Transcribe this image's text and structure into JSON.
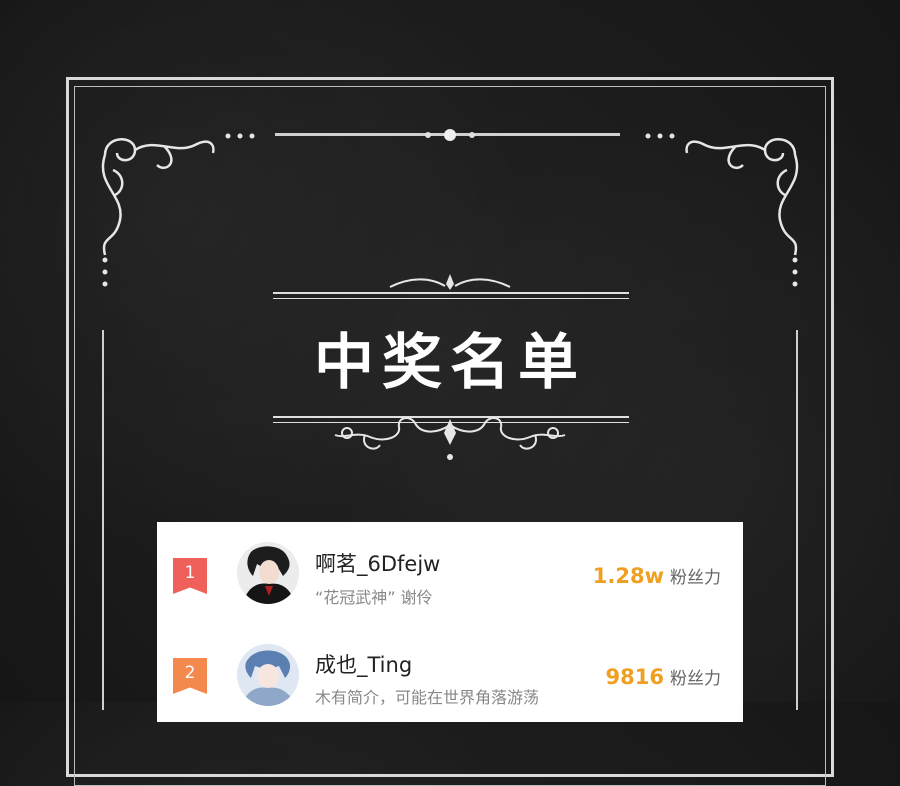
{
  "title": "中奖名单",
  "colors": {
    "badge_first": "#f0605a",
    "badge_second": "#f4894d",
    "fans_accent": "#f0a020"
  },
  "winners": [
    {
      "rank": "1",
      "name": "啊茗_6Dfejw",
      "signature": "“花冠武神” 谢伶",
      "fans_count": "1.28w",
      "fans_label": "粉丝力"
    },
    {
      "rank": "2",
      "name": "成也_Ting",
      "signature": "木有简介，可能在世界角落游荡",
      "fans_count": "9816",
      "fans_label": "粉丝力"
    }
  ]
}
